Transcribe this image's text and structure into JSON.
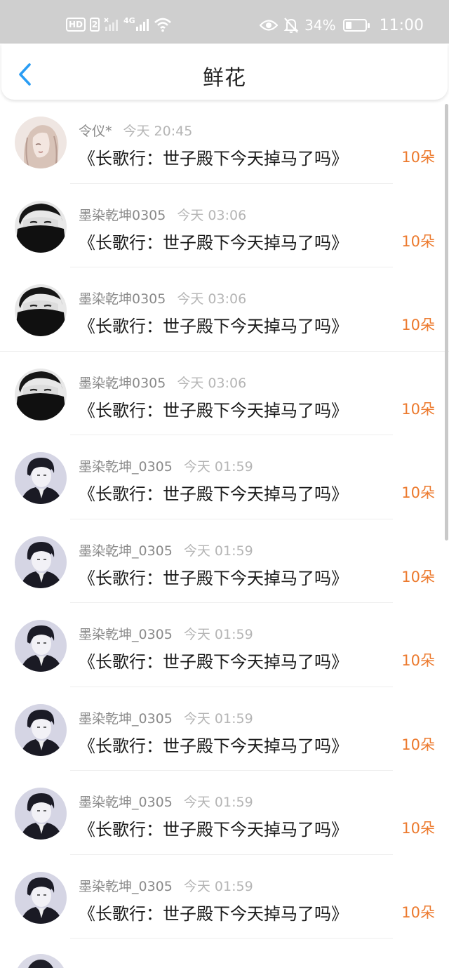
{
  "status_bar": {
    "hd": "HD",
    "sim": "2",
    "net": "4G",
    "battery_text": "34%",
    "battery_level": 0.34,
    "time": "11:00"
  },
  "header": {
    "title": "鲜花",
    "back_icon": "chevron-left-icon"
  },
  "items": [
    {
      "user": "令仪*",
      "time": "今天 20:45",
      "book": "《长歌行：世子殿下今天掉马了吗》",
      "count": "10朵",
      "avatar": "girl-sketch"
    },
    {
      "user": "墨染乾坤0305",
      "time": "今天 03:06",
      "book": "《长歌行：世子殿下今天掉马了吗》",
      "count": "10朵",
      "avatar": "masked-man"
    },
    {
      "user": "墨染乾坤0305",
      "time": "今天 03:06",
      "book": "《长歌行：世子殿下今天掉马了吗》",
      "count": "10朵",
      "avatar": "masked-man"
    },
    {
      "user": "墨染乾坤0305",
      "time": "今天 03:06",
      "book": "《长歌行：世子殿下今天掉马了吗》",
      "count": "10朵",
      "avatar": "masked-man"
    },
    {
      "user": "墨染乾坤_0305",
      "time": "今天 01:59",
      "book": "《长歌行：世子殿下今天掉马了吗》",
      "count": "10朵",
      "avatar": "suit-man"
    },
    {
      "user": "墨染乾坤_0305",
      "time": "今天 01:59",
      "book": "《长歌行：世子殿下今天掉马了吗》",
      "count": "10朵",
      "avatar": "suit-man"
    },
    {
      "user": "墨染乾坤_0305",
      "time": "今天 01:59",
      "book": "《长歌行：世子殿下今天掉马了吗》",
      "count": "10朵",
      "avatar": "suit-man"
    },
    {
      "user": "墨染乾坤_0305",
      "time": "今天 01:59",
      "book": "《长歌行：世子殿下今天掉马了吗》",
      "count": "10朵",
      "avatar": "suit-man"
    },
    {
      "user": "墨染乾坤_0305",
      "time": "今天 01:59",
      "book": "《长歌行：世子殿下今天掉马了吗》",
      "count": "10朵",
      "avatar": "suit-man"
    },
    {
      "user": "墨染乾坤_0305",
      "time": "今天 01:59",
      "book": "《长歌行：世子殿下今天掉马了吗》",
      "count": "10朵",
      "avatar": "suit-man"
    }
  ],
  "colors": {
    "accent": "#ec7a2e",
    "back_icon": "#2a9df4",
    "status_bar_bg": "#cfcfcf"
  }
}
